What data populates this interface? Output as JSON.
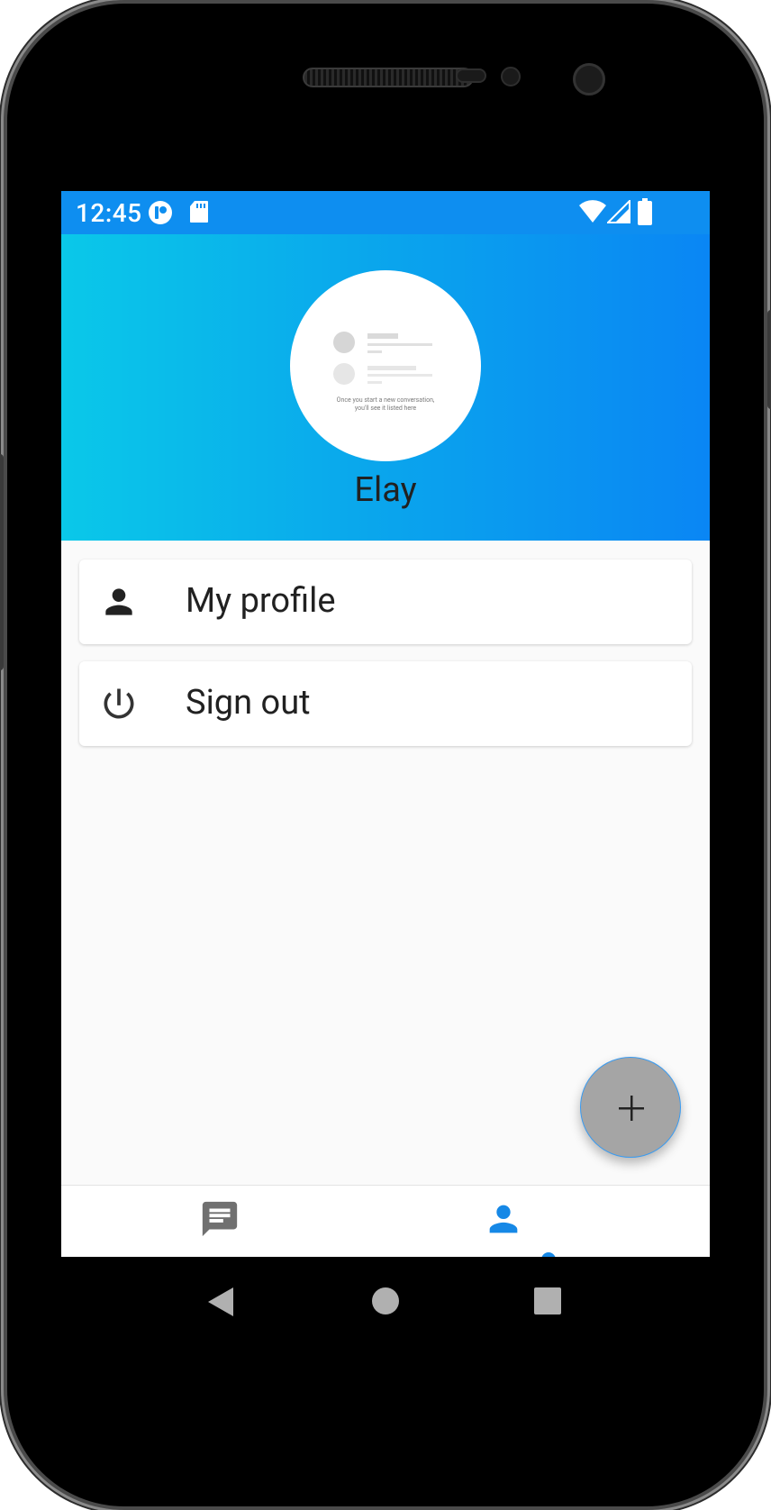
{
  "status_bar": {
    "time": "12:45",
    "background": "#0e8ef0",
    "left_icons": [
      "app-notification-icon",
      "sd-card-icon"
    ],
    "right_icons": [
      "wifi-icon",
      "signal-icon",
      "battery-icon"
    ]
  },
  "profile_header": {
    "username": "Elay",
    "gradient": [
      "#0ac8e9",
      "#0a86f4"
    ],
    "avatar_caption_line1": "Once you start a new conversation,",
    "avatar_caption_line2": "you'll see it listed here"
  },
  "menu": {
    "items": [
      {
        "label": "My profile",
        "icon": "person-icon"
      },
      {
        "label": "Sign out",
        "icon": "power-icon"
      }
    ]
  },
  "fab": {
    "icon": "plus-icon",
    "color": "#a5a5a5"
  },
  "bottom_nav": {
    "items": [
      {
        "icon": "chat-icon",
        "active": false
      },
      {
        "icon": "person-icon",
        "active": true
      }
    ],
    "active_color": "#1688e6"
  },
  "system_nav": {
    "buttons": [
      "back-icon",
      "home-icon",
      "recents-icon"
    ]
  }
}
